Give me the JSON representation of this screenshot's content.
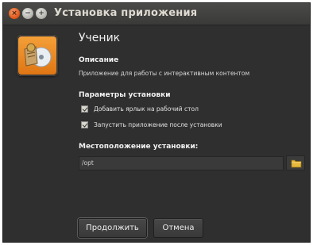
{
  "window": {
    "title": "Установка приложения",
    "controls": [
      "close-icon",
      "minimize-icon",
      "maximize-icon"
    ]
  },
  "app": {
    "name": "Ученик",
    "icon": "book-disc-icon"
  },
  "description": {
    "heading": "Описание",
    "text": "Приложение для работы с интерактивным контентом"
  },
  "options": {
    "heading": "Параметры установки",
    "items": [
      {
        "label": "Добавить ярлык на рабочий стол",
        "checked": true
      },
      {
        "label": "Запустить приложение после установки",
        "checked": true
      }
    ]
  },
  "location": {
    "heading": "Местоположение установки:",
    "value": "/opt",
    "browse_icon": "folder-icon"
  },
  "buttons": {
    "continue_label": "Продолжить",
    "cancel_label": "Отмена"
  },
  "colors": {
    "background": "#2f2f2f",
    "titlebar": "#3f3f3d",
    "close_button": "#e25b1e",
    "icon_accent": "#de7412"
  }
}
